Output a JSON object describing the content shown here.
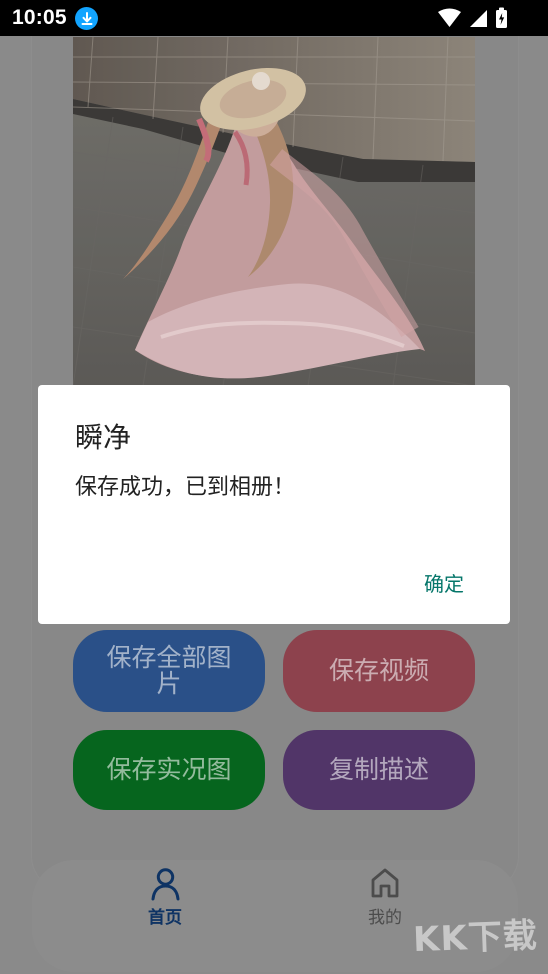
{
  "status_bar": {
    "time": "10:05",
    "download_icon": "download-icon",
    "wifi_icon": "wifi-icon",
    "signal_icon": "signal-icon",
    "battery_icon": "battery-icon"
  },
  "main": {
    "photo_description": "",
    "buttons": {
      "save_all_images": "保存全部图片",
      "save_video": "保存视频",
      "save_live_photo": "保存实况图",
      "copy_description": "复制描述"
    }
  },
  "dialog": {
    "title": "瞬净",
    "message": "保存成功，已到相册！",
    "ok": "确定"
  },
  "bottom_nav": {
    "home": "首页",
    "mine": "我的"
  },
  "watermark": "KK下载"
}
